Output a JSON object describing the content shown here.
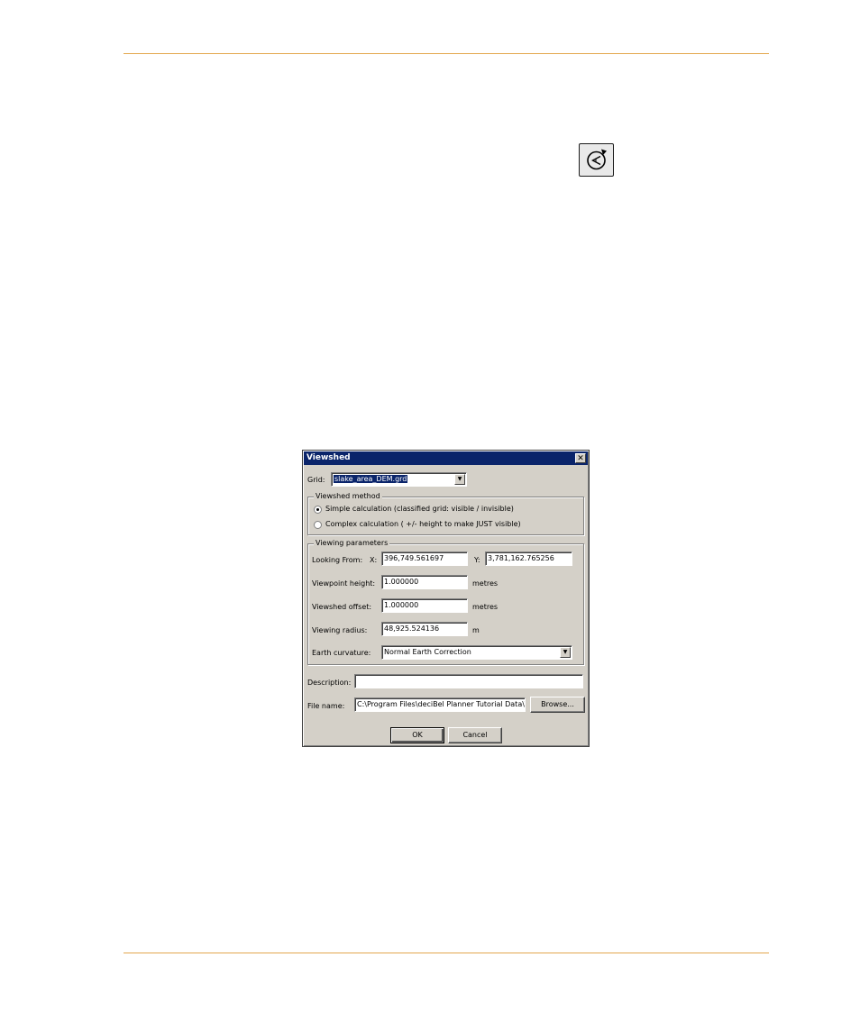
{
  "page": {
    "accent_color": "#e3a74e",
    "toolbar_icon": "viewshed-tool-icon"
  },
  "dialog": {
    "title": "Viewshed",
    "close_label": "✕",
    "grid": {
      "label": "Grid:",
      "value": "slake_area_DEM.grd"
    },
    "method": {
      "legend": "Viewshed method",
      "options": [
        {
          "label": "Simple calculation (classified grid: visible / invisible)",
          "selected": true
        },
        {
          "label": "Complex calculation ( +/- height to make JUST visible)",
          "selected": false
        }
      ]
    },
    "params": {
      "legend": "Viewing parameters",
      "looking_from_label": "Looking From:",
      "x_label": "X:",
      "x_value": "396,749.561697",
      "y_label": "Y:",
      "y_value": "3,781,162.765256",
      "height_label": "Viewpoint height:",
      "height_value": "1.000000",
      "height_unit": "metres",
      "offset_label": "Viewshed offset:",
      "offset_value": "1.000000",
      "offset_unit": "metres",
      "radius_label": "Viewing radius:",
      "radius_value": "48,925.524136",
      "radius_unit": "m",
      "curvature_label": "Earth curvature:",
      "curvature_value": "Normal Earth Correction"
    },
    "description": {
      "label": "Description:",
      "value": ""
    },
    "file": {
      "label": "File name:",
      "value": "C:\\Program Files\\deciBel Planner Tutorial Data\\Tu",
      "browse_label": "Browse..."
    },
    "buttons": {
      "ok": "OK",
      "cancel": "Cancel"
    }
  }
}
